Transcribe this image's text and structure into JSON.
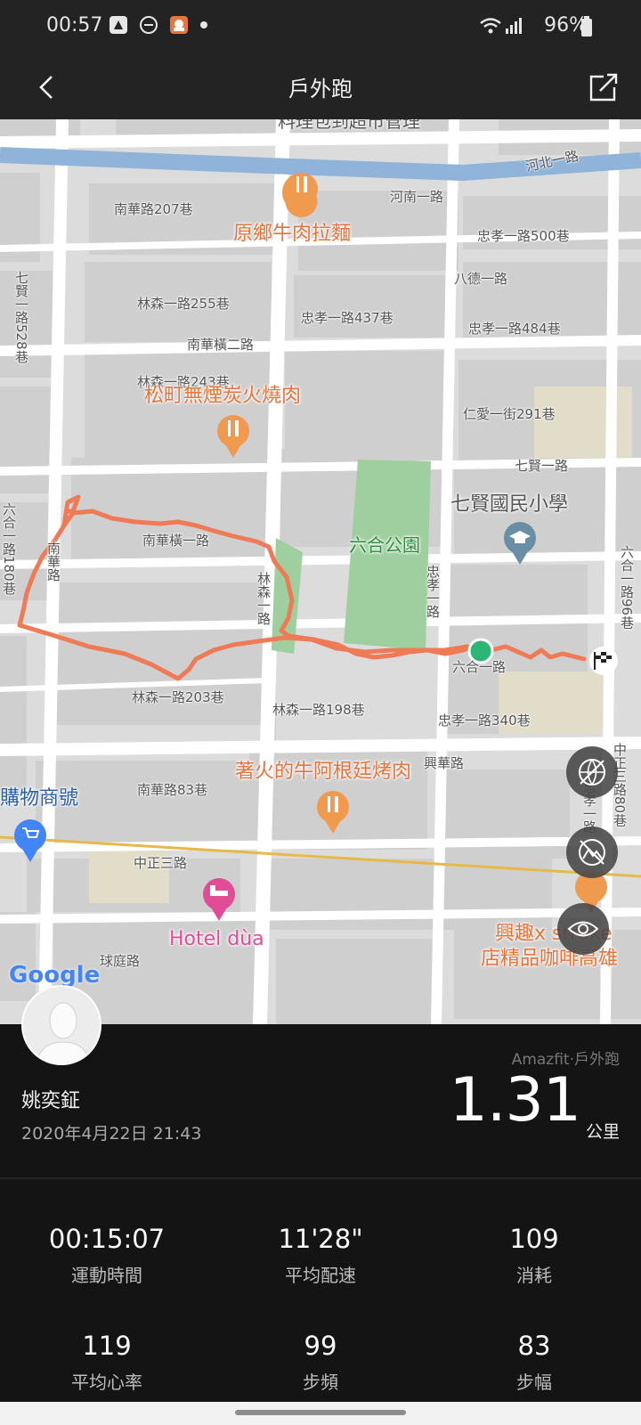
{
  "status_bar": {
    "time": "00:57",
    "battery": "96%",
    "icons": [
      "app-icon",
      "do-not-disturb-icon",
      "app-icon",
      "dot-icon",
      "wifi-icon",
      "signal-icon",
      "battery-icon"
    ]
  },
  "nav": {
    "title": "戶外跑",
    "back_icon": "chevron-left-icon",
    "share_icon": "share-icon"
  },
  "map": {
    "poi": {
      "noodle": "原鄉牛肉拉麵",
      "bbq": "松町無煙炭火燒肉",
      "park": "六合公園",
      "school": "七賢國民小學",
      "steak": "著火的牛阿根廷烤肉",
      "shop": "購物商號",
      "hotel": "Hotel dùa",
      "cafe1": "興趣x stroke",
      "cafe2": "店精品咖啡高雄",
      "top_cut": "料理包到超市管理"
    },
    "roads": {
      "r1": "河北一路",
      "r2": "河南一路",
      "r3": "南華路207巷",
      "r4": "忠孝一路500巷",
      "r5": "八德一路",
      "r6": "林森一路255巷",
      "r7": "忠孝一路437巷",
      "r8": "忠孝一路484巷",
      "r9": "南華橫二路",
      "r10": "林森一路243巷",
      "r11": "仁愛一街291巷",
      "r12": "七賢一路",
      "r13": "七賢一路528巷",
      "r14": "六合一路180巷",
      "r15": "南華橫一路",
      "r16": "南華路",
      "r17": "林森一路",
      "r18": "忠孝一路",
      "r19": "六合一路96巷",
      "r20": "六合一路",
      "r21": "林森一路203巷",
      "r22": "林森一路198巷",
      "r23": "忠孝一路340巷",
      "r24": "興華路",
      "r25": "南華路83巷",
      "r26": "中正三路",
      "r27": "球庭路",
      "r28": "中正三路80巷",
      "r29": "忠孝一路"
    },
    "google": "Google",
    "controls": [
      "satellite-off-icon",
      "terrain-off-icon",
      "eye-icon"
    ],
    "route_color": "#ef7a56",
    "start_color": "#2bb673"
  },
  "profile": {
    "name": "姚奕鉦",
    "date": "2020年4月22日 21:43",
    "source": "Amazfit·戶外跑",
    "distance": "1.31",
    "distance_unit": "公里"
  },
  "stats": [
    {
      "value": "00:15:07",
      "label": "運動時間"
    },
    {
      "value": "11'28\"",
      "label": "平均配速"
    },
    {
      "value": "109",
      "label": "消耗"
    },
    {
      "value": "119",
      "label": "平均心率"
    },
    {
      "value": "99",
      "label": "步頻"
    },
    {
      "value": "83",
      "label": "步幅"
    }
  ]
}
